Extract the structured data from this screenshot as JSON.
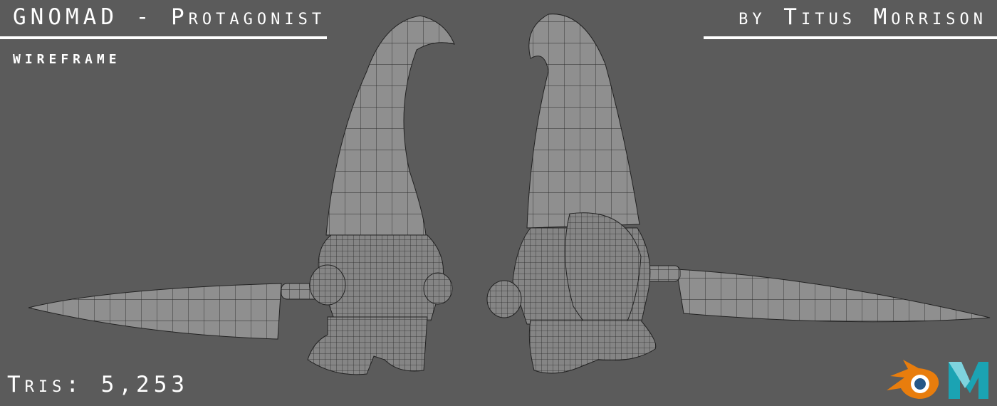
{
  "header": {
    "title": "GNOMAD - Protagonist",
    "subtitle": "wireframe",
    "author": "by Titus Morrison"
  },
  "footer": {
    "tris_label": "Tris: 5,253",
    "logos": [
      "blender-logo",
      "maya-logo"
    ]
  },
  "colors": {
    "background": "#5b5b5b",
    "mesh": "#8c8c8c",
    "wire": "#2a2a2a",
    "blender_orange": "#e87d0d",
    "blender_blue": "#265787",
    "maya_teal": "#1ba3b3"
  }
}
